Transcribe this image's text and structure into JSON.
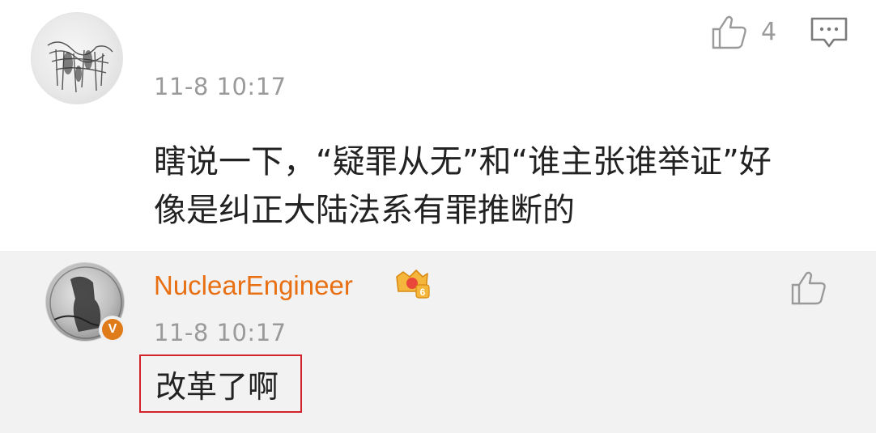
{
  "main_comment": {
    "timestamp": "11-8 10:17",
    "like_count": "4",
    "text": "瞎说一下，“疑罪从无”和“谁主张谁举证”好像是纠正大陆法系有罪推断的",
    "icons": {
      "like": "thumbs-up-icon",
      "reply": "comment-bubble-icon"
    }
  },
  "reply": {
    "username": "NuclearEngineer",
    "verified_badge": "V",
    "vip_level": "6",
    "timestamp": "11-8 10:17",
    "text": "改革了啊",
    "highlight_color": "#d2232a",
    "username_color": "#e86f12",
    "icons": {
      "like": "thumbs-up-icon",
      "vip": "crown-badge-icon"
    }
  }
}
